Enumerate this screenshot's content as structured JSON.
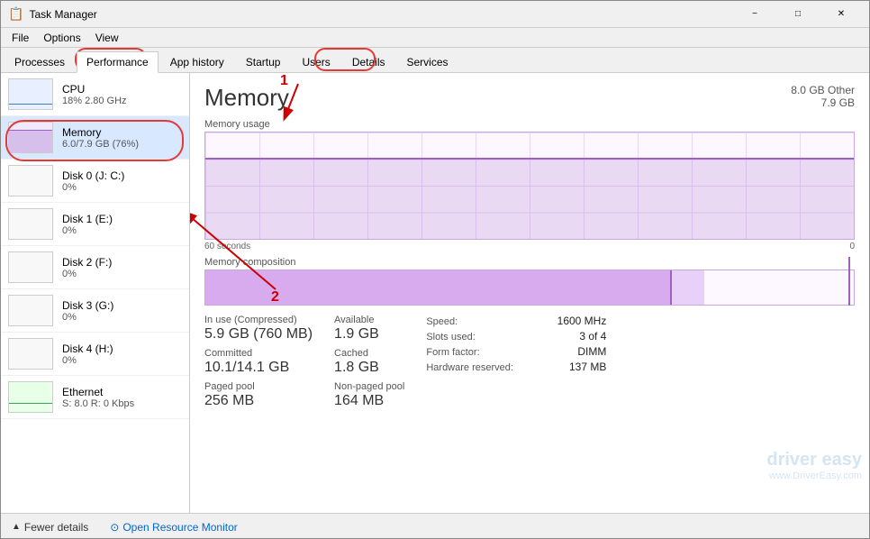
{
  "window": {
    "title": "Task Manager",
    "icon": "⚙"
  },
  "menu": {
    "items": [
      "File",
      "Options",
      "View"
    ]
  },
  "tabs": [
    {
      "label": "Processes",
      "active": false
    },
    {
      "label": "Performance",
      "active": true,
      "highlighted": true
    },
    {
      "label": "App history",
      "active": false
    },
    {
      "label": "Startup",
      "active": false
    },
    {
      "label": "Users",
      "active": false
    },
    {
      "label": "Details",
      "active": false
    },
    {
      "label": "Services",
      "active": false,
      "highlighted_circle": true
    }
  ],
  "sidebar": {
    "items": [
      {
        "name": "CPU",
        "value": "18% 2.80 GHz",
        "type": "cpu"
      },
      {
        "name": "Memory",
        "value": "6.0/7.9 GB (76%)",
        "type": "memory",
        "selected": true
      },
      {
        "name": "Disk 0 (J: C:)",
        "value": "0%",
        "type": "disk"
      },
      {
        "name": "Disk 1 (E:)",
        "value": "0%",
        "type": "disk"
      },
      {
        "name": "Disk 2 (F:)",
        "value": "0%",
        "type": "disk"
      },
      {
        "name": "Disk 3 (G:)",
        "value": "0%",
        "type": "disk"
      },
      {
        "name": "Disk 4 (H:)",
        "value": "0%",
        "type": "disk"
      },
      {
        "name": "Ethernet",
        "value": "S: 8.0  R: 0 Kbps",
        "type": "ethernet"
      }
    ]
  },
  "main": {
    "title": "Memory",
    "subtitle_line1": "8.0 GB Other",
    "subtitle_line2": "7.9 GB",
    "graph": {
      "label": "Memory usage",
      "max_label": "7.9 GB",
      "time_label": "60 seconds",
      "zero_label": "0"
    },
    "composition": {
      "label": "Memory composition"
    },
    "stats": {
      "in_use_label": "In use (Compressed)",
      "in_use_value": "5.9 GB (760 MB)",
      "available_label": "Available",
      "available_value": "1.9 GB",
      "committed_label": "Committed",
      "committed_value": "10.1/14.1 GB",
      "cached_label": "Cached",
      "cached_value": "1.8 GB",
      "paged_pool_label": "Paged pool",
      "paged_pool_value": "256 MB",
      "non_paged_pool_label": "Non-paged pool",
      "non_paged_pool_value": "164 MB",
      "speed_label": "Speed:",
      "speed_value": "1600 MHz",
      "slots_label": "Slots used:",
      "slots_value": "3 of 4",
      "form_label": "Form factor:",
      "form_value": "DIMM",
      "hw_reserved_label": "Hardware reserved:",
      "hw_reserved_value": "137 MB"
    }
  },
  "status_bar": {
    "fewer_details_label": "Fewer details",
    "resource_monitor_label": "Open Resource Monitor"
  },
  "annotations": {
    "one": "1",
    "two": "2"
  }
}
